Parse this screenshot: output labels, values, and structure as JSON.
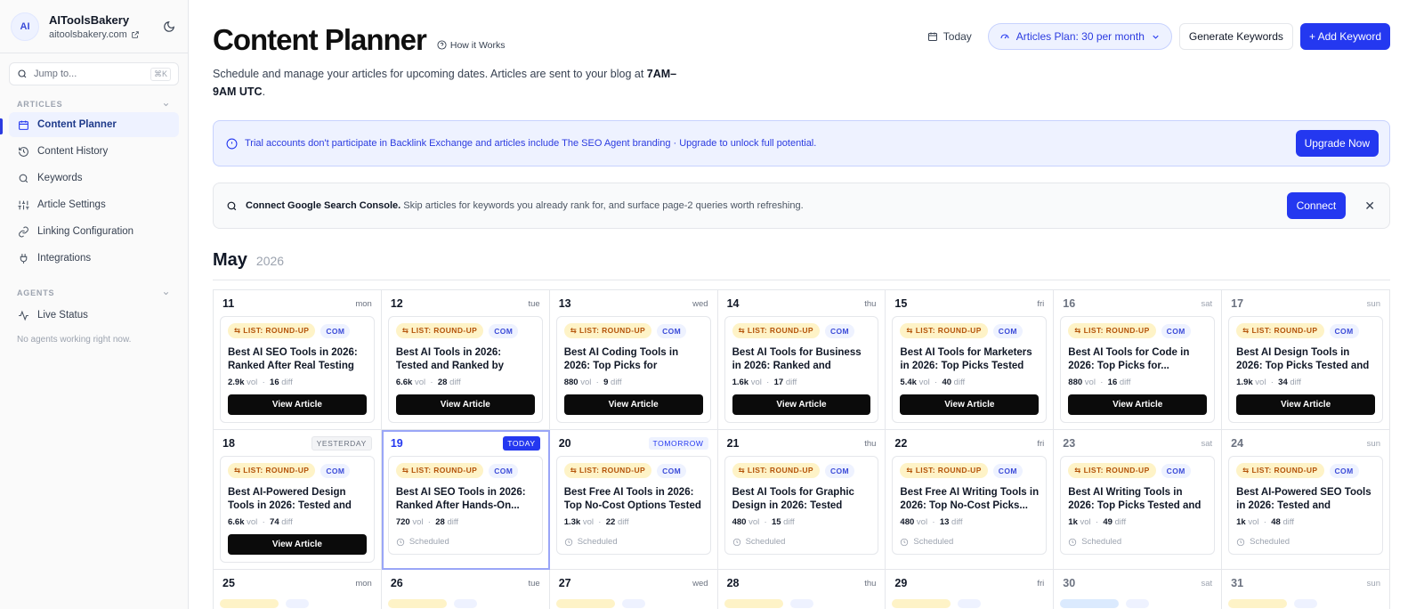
{
  "sidebar": {
    "avatar": "AI",
    "brand_name": "AIToolsBakery",
    "brand_url": "aitoolsbakery.com",
    "jump_placeholder": "Jump to...",
    "jump_kbd": "⌘K",
    "articles_header": "ARTICLES",
    "articles_items": [
      {
        "label": "Content Planner",
        "icon": "calendar-icon",
        "active": true
      },
      {
        "label": "Content History",
        "icon": "history-icon"
      },
      {
        "label": "Keywords",
        "icon": "search-icon"
      },
      {
        "label": "Article Settings",
        "icon": "sliders-icon"
      },
      {
        "label": "Linking Configuration",
        "icon": "link-icon"
      },
      {
        "label": "Integrations",
        "icon": "plug-icon"
      }
    ],
    "agents_header": "AGENTS",
    "agents_items": [
      {
        "label": "Live Status",
        "icon": "activity-icon"
      }
    ],
    "no_agents": "No agents working right now."
  },
  "header": {
    "title": "Content Planner",
    "how_it_works": "How it Works",
    "subtitle_pre": "Schedule and manage your articles for upcoming dates. Articles are sent to your blog at ",
    "subtitle_time": "7AM–9AM UTC",
    "subtitle_post": ".",
    "today_label": "Today",
    "plan_label": "Articles Plan: 30 per month",
    "generate_label": "Generate Keywords",
    "add_label": "+ Add Keyword"
  },
  "trial_banner": {
    "text": "Trial accounts don't participate in Backlink Exchange and articles include The SEO Agent branding · Upgrade to unlock full potential.",
    "button": "Upgrade Now"
  },
  "gsc_banner": {
    "title": "Connect Google Search Console.",
    "text": "Skip articles for keywords you already rank for, and surface page-2 queries worth refreshing.",
    "button": "Connect"
  },
  "calendar": {
    "month": "May",
    "year": "2026",
    "view_label": "View Article",
    "scheduled_label": "Scheduled",
    "vol_label": "vol",
    "diff_label": "diff",
    "week1": [
      {
        "day": "11",
        "dow": "mon",
        "type": "LIST: ROUND-UP",
        "tld": "COM",
        "title": "Best AI SEO Tools in 2026: Ranked After Real Testing",
        "vol": "2.9k",
        "diff": "16"
      },
      {
        "day": "12",
        "dow": "tue",
        "type": "LIST: ROUND-UP",
        "tld": "COM",
        "title": "Best AI Tools in 2026: Tested and Ranked by Category",
        "vol": "6.6k",
        "diff": "28"
      },
      {
        "day": "13",
        "dow": "wed",
        "type": "LIST: ROUND-UP",
        "tld": "COM",
        "title": "Best AI Coding Tools in 2026: Top Picks for Developers",
        "vol": "880",
        "diff": "9"
      },
      {
        "day": "14",
        "dow": "thu",
        "type": "LIST: ROUND-UP",
        "tld": "COM",
        "title": "Best AI Tools for Business in 2026: Ranked and Reviewed",
        "vol": "1.6k",
        "diff": "17"
      },
      {
        "day": "15",
        "dow": "fri",
        "type": "LIST: ROUND-UP",
        "tld": "COM",
        "title": "Best AI Tools for Marketers in 2026: Top Picks Tested",
        "vol": "5.4k",
        "diff": "40"
      },
      {
        "day": "16",
        "dow": "sat",
        "type": "LIST: ROUND-UP",
        "tld": "COM",
        "title": "Best AI Tools for Code in 2026: Top Picks for...",
        "vol": "880",
        "diff": "16"
      },
      {
        "day": "17",
        "dow": "sun",
        "type": "LIST: ROUND-UP",
        "tld": "COM",
        "title": "Best AI Design Tools in 2026: Top Picks Tested and Ranked",
        "vol": "1.9k",
        "diff": "34"
      }
    ],
    "week2": [
      {
        "day": "18",
        "dow": "YESTERDAY",
        "type": "LIST: ROUND-UP",
        "tld": "COM",
        "title": "Best AI-Powered Design Tools in 2026: Tested and Ranked",
        "vol": "6.6k",
        "diff": "74"
      },
      {
        "day": "19",
        "dow": "TODAY",
        "type": "LIST: ROUND-UP",
        "tld": "COM",
        "title": "Best AI SEO Tools in 2026: Ranked After Hands-On...",
        "vol": "720",
        "diff": "28"
      },
      {
        "day": "20",
        "dow": "TOMORROW",
        "type": "LIST: ROUND-UP",
        "tld": "COM",
        "title": "Best Free AI Tools in 2026: Top No-Cost Options Tested",
        "vol": "1.3k",
        "diff": "22"
      },
      {
        "day": "21",
        "dow": "thu",
        "type": "LIST: ROUND-UP",
        "tld": "COM",
        "title": "Best AI Tools for Graphic Design in 2026: Tested and...",
        "vol": "480",
        "diff": "15"
      },
      {
        "day": "22",
        "dow": "fri",
        "type": "LIST: ROUND-UP",
        "tld": "COM",
        "title": "Best Free AI Writing Tools in 2026: Top No-Cost Picks...",
        "vol": "480",
        "diff": "13"
      },
      {
        "day": "23",
        "dow": "sat",
        "type": "LIST: ROUND-UP",
        "tld": "COM",
        "title": "Best AI Writing Tools in 2026: Top Picks Tested and Ranked",
        "vol": "1k",
        "diff": "49"
      },
      {
        "day": "24",
        "dow": "sun",
        "type": "LIST: ROUND-UP",
        "tld": "COM",
        "title": "Best AI-Powered SEO Tools in 2026: Tested and Compared",
        "vol": "1k",
        "diff": "48"
      }
    ],
    "week3": [
      {
        "day": "25",
        "dow": "mon"
      },
      {
        "day": "26",
        "dow": "tue"
      },
      {
        "day": "27",
        "dow": "wed"
      },
      {
        "day": "28",
        "dow": "thu"
      },
      {
        "day": "29",
        "dow": "fri"
      },
      {
        "day": "30",
        "dow": "sat"
      },
      {
        "day": "31",
        "dow": "sun"
      }
    ]
  },
  "colors": {
    "accent": "#2438f0",
    "badge_type_bg": "#fef3c7",
    "badge_type_fg": "#b45309"
  }
}
